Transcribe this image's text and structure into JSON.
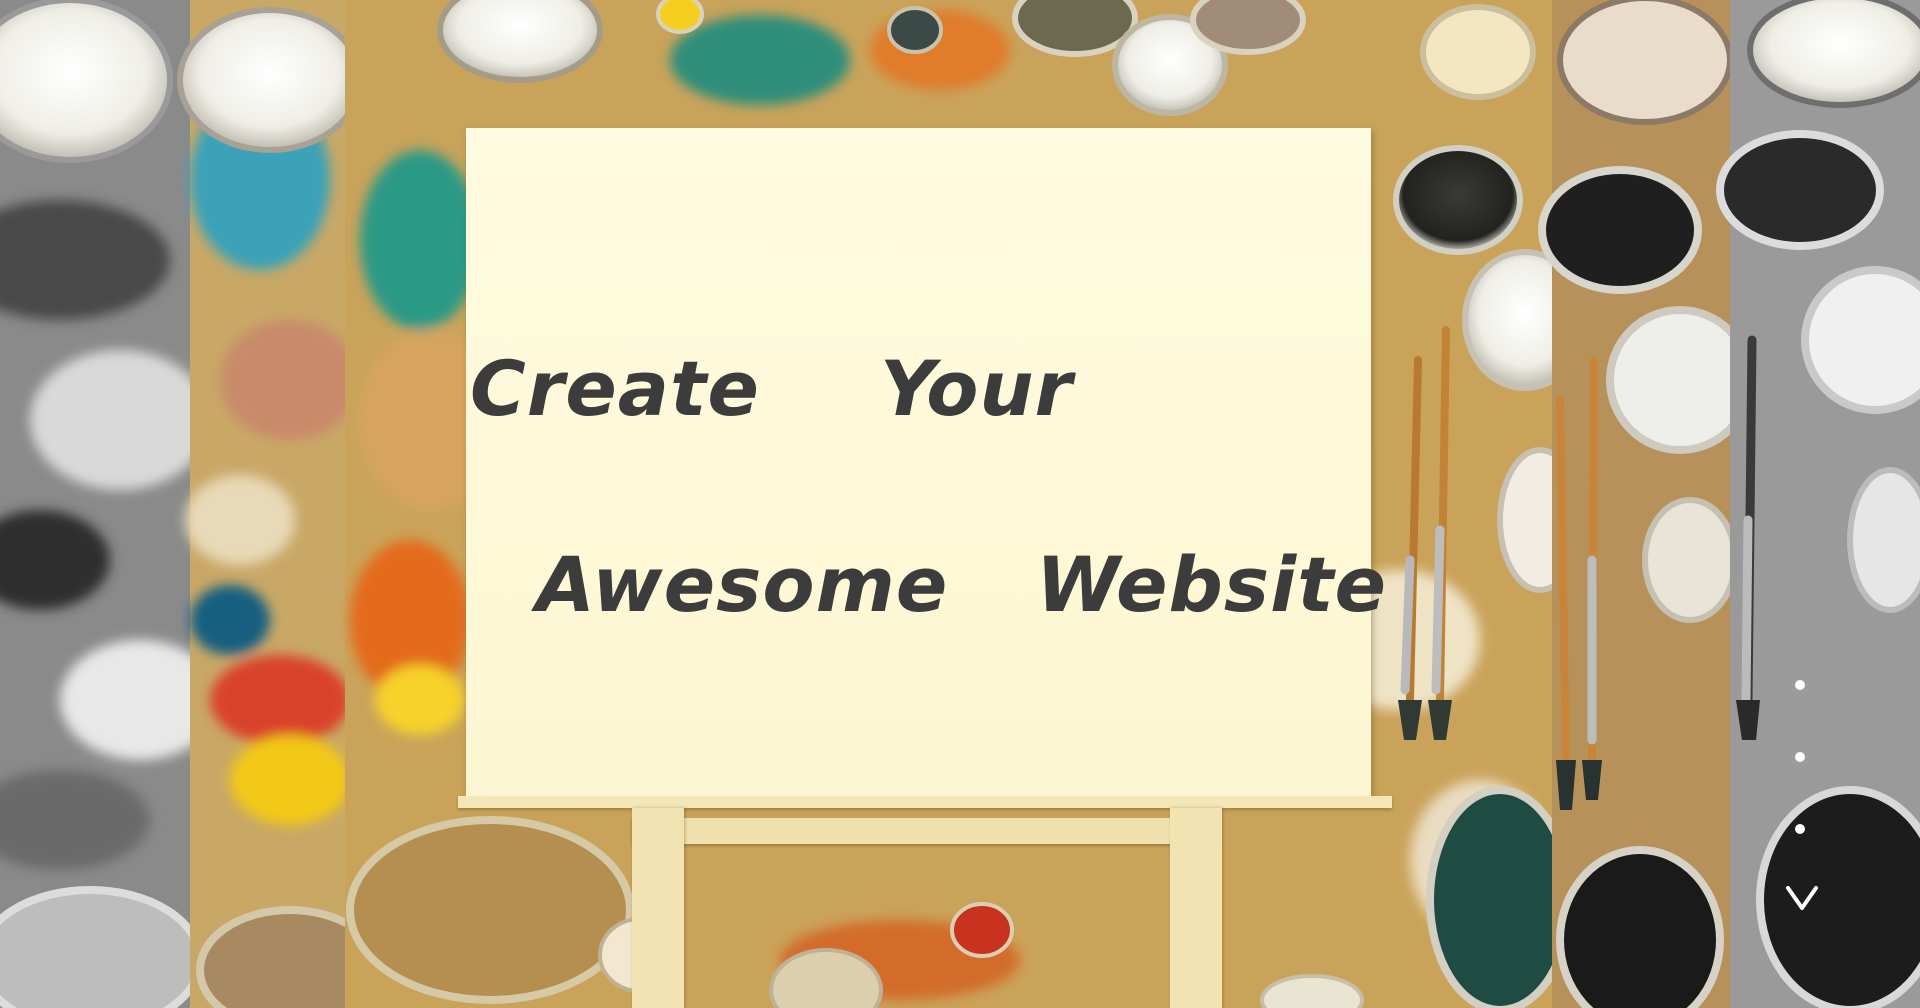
{
  "hero": {
    "words": [
      "Create",
      "Your",
      "Awesome",
      "Website"
    ]
  },
  "slider": {
    "dot_count": 3
  },
  "colors": {
    "heading": "#3c3c3c",
    "canvas": "#fdf6d2",
    "table": "#c9a458",
    "indicator": "#ffffff"
  },
  "icons": {
    "scroll": "chevron-down-icon"
  }
}
